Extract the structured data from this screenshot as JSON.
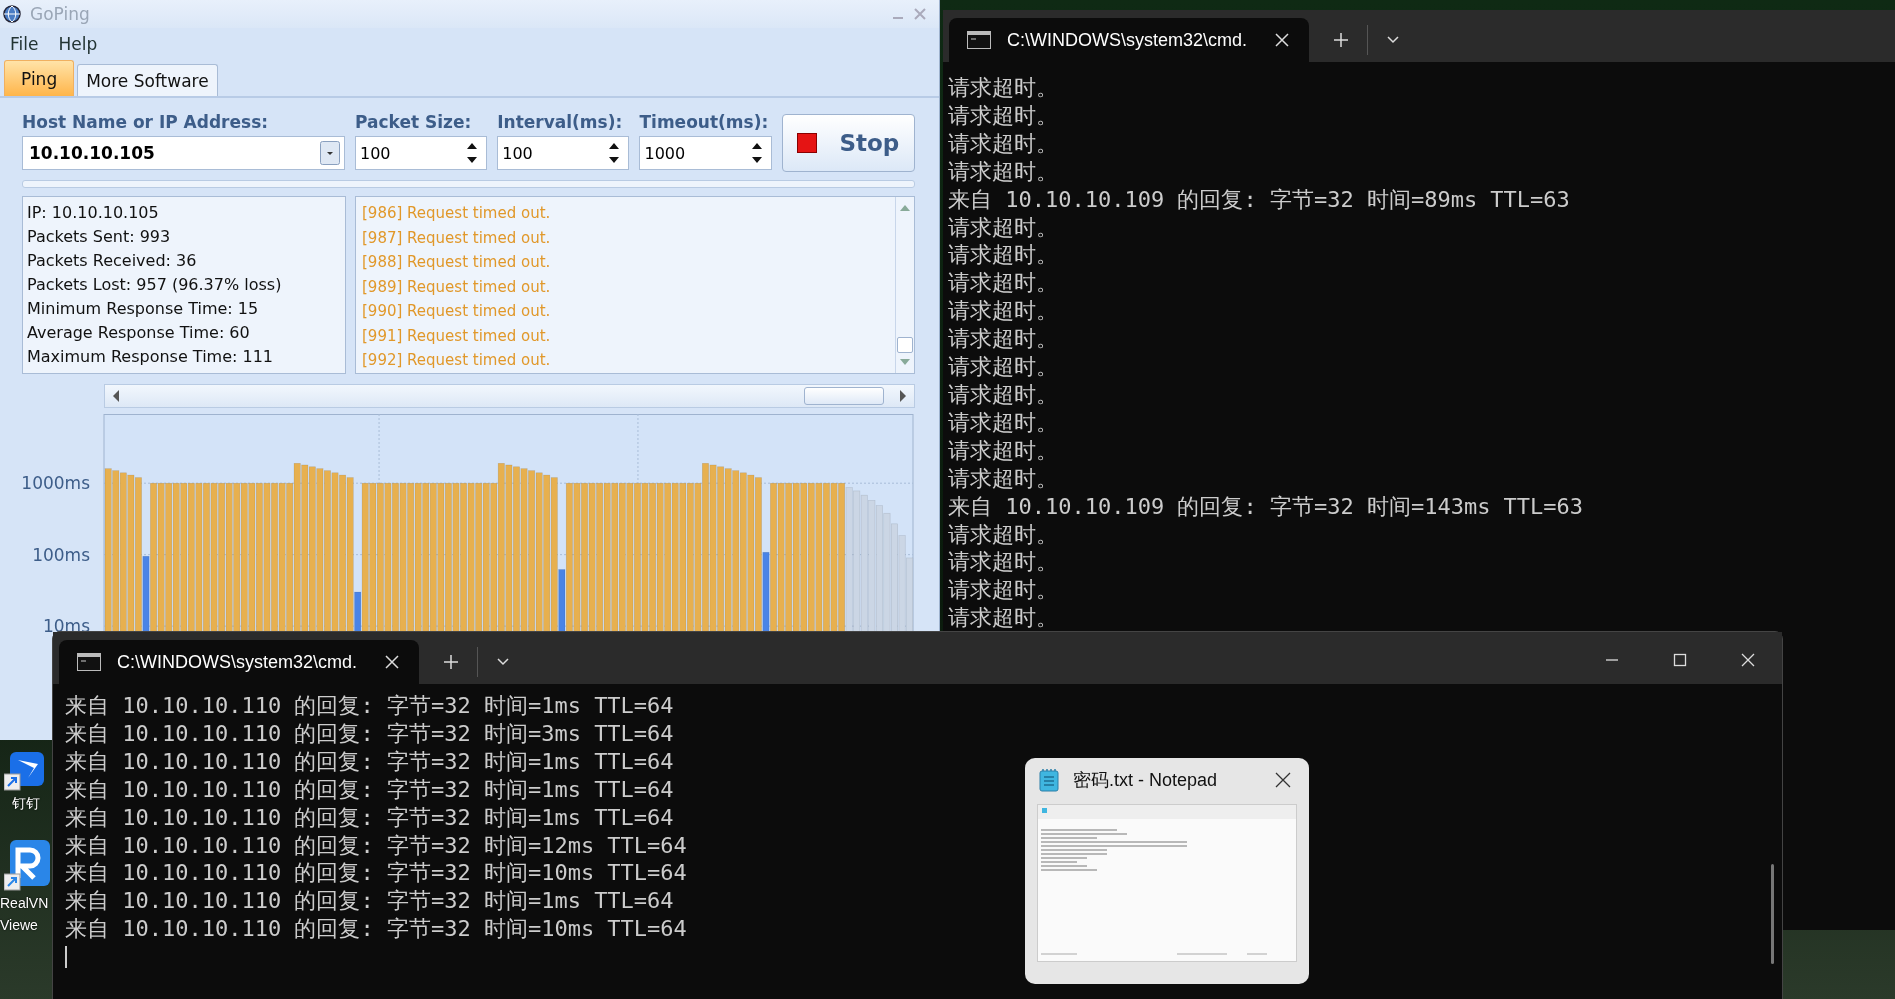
{
  "desktop_icons": [
    {
      "kind": "wing",
      "label_lines": [
        "钉钉"
      ]
    },
    {
      "kind": "letter",
      "label_lines": [
        "RealVN",
        "Viewe"
      ]
    }
  ],
  "goping": {
    "title": "GoPing",
    "menu": [
      "File",
      "Help"
    ],
    "tabs": [
      {
        "label": "Ping",
        "selected": true
      },
      {
        "label": "More Software",
        "selected": false
      }
    ],
    "host": {
      "label": "Host Name or IP Address:",
      "value": "10.10.10.105"
    },
    "spinners": [
      {
        "label": "Packet Size:",
        "value": "100"
      },
      {
        "label": "Interval(ms):",
        "value": "100"
      },
      {
        "label": "Timeout(ms):",
        "value": "1000"
      }
    ],
    "stop_button": "Stop",
    "stats": [
      "IP: 10.10.10.105",
      "Packets Sent: 993",
      "Packets Received: 36",
      "Packets Lost: 957 (96.37% loss)",
      "Minimum Response Time: 15",
      "Average Response Time: 60",
      "Maximum Response Time: 111"
    ],
    "log": [
      "[986] Request timed out.",
      "[987] Request timed out.",
      "[988] Request timed out.",
      "[989] Request timed out.",
      "[990] Request timed out.",
      "[991] Request timed out.",
      "[992] Request timed out."
    ],
    "response_chart": {
      "y_labels": [
        "1000ms",
        "100ms",
        "10ms"
      ]
    }
  },
  "cmd_right": {
    "title": "C:\\WINDOWS\\system32\\cmd.",
    "lines": [
      "请求超时。",
      "请求超时。",
      "请求超时。",
      "请求超时。",
      "来自 10.10.10.109 的回复: 字节=32 时间=89ms TTL=63",
      "请求超时。",
      "请求超时。",
      "请求超时。",
      "请求超时。",
      "请求超时。",
      "请求超时。",
      "请求超时。",
      "请求超时。",
      "请求超时。",
      "请求超时。",
      "来自 10.10.10.109 的回复: 字节=32 时间=143ms TTL=63",
      "请求超时。",
      "请求超时。",
      "请求超时。",
      "请求超时。"
    ]
  },
  "cmd_bottom": {
    "title": "C:\\WINDOWS\\system32\\cmd.",
    "lines": [
      "来自 10.10.10.110 的回复: 字节=32 时间=1ms TTL=64",
      "来自 10.10.10.110 的回复: 字节=32 时间=3ms TTL=64",
      "来自 10.10.10.110 的回复: 字节=32 时间=1ms TTL=64",
      "来自 10.10.10.110 的回复: 字节=32 时间=1ms TTL=64",
      "来自 10.10.10.110 的回复: 字节=32 时间=1ms TTL=64",
      "来自 10.10.10.110 的回复: 字节=32 时间=12ms TTL=64",
      "来自 10.10.10.110 的回复: 字节=32 时间=10ms TTL=64",
      "来自 10.10.10.110 的回复: 字节=32 时间=1ms TTL=64",
      "来自 10.10.10.110 的回复: 字节=32 时间=10ms TTL=64"
    ]
  },
  "notepad_preview": {
    "title": "密码.txt - Notepad"
  }
}
